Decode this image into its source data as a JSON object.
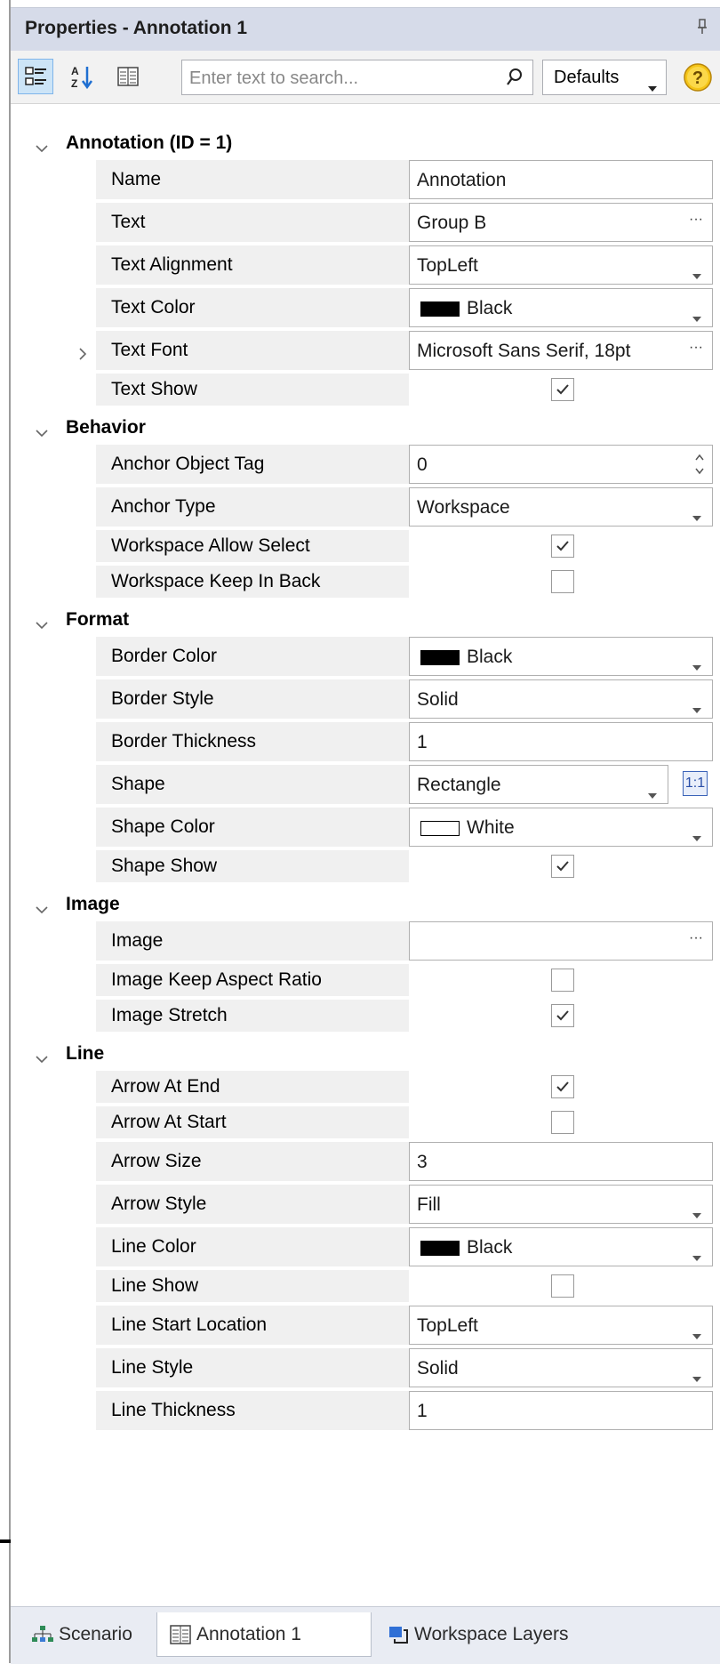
{
  "panel": {
    "title": "Properties - Annotation 1",
    "pin_icon": "pin-icon"
  },
  "toolbar": {
    "categorized_icon": "categorized-view-icon",
    "alphabetical_icon": "sort-az-icon",
    "pages_icon": "property-pages-icon",
    "search_placeholder": "Enter text to search...",
    "search_icon": "search-icon",
    "defaults_label": "Defaults",
    "help_icon": "help-icon"
  },
  "categories": [
    {
      "label": "Annotation (ID = 1)",
      "properties": [
        {
          "name": "Name",
          "type": "text",
          "value": "Annotation"
        },
        {
          "name": "Text",
          "type": "ellipsis",
          "value": "Group B"
        },
        {
          "name": "Text Alignment",
          "type": "dropdown",
          "value": "TopLeft"
        },
        {
          "name": "Text Color",
          "type": "color",
          "value": "Black",
          "swatch": "#000000"
        },
        {
          "name": "Text Font",
          "type": "ellipsis",
          "value": "Microsoft Sans Serif, 18pt",
          "expandable": true
        },
        {
          "name": "Text Show",
          "type": "checkbox",
          "checked": true
        }
      ]
    },
    {
      "label": "Behavior",
      "properties": [
        {
          "name": "Anchor Object Tag",
          "type": "spin",
          "value": "0"
        },
        {
          "name": "Anchor Type",
          "type": "dropdown",
          "value": "Workspace"
        },
        {
          "name": "Workspace Allow Select",
          "type": "checkbox",
          "checked": true
        },
        {
          "name": "Workspace Keep In Back",
          "type": "checkbox",
          "checked": false
        }
      ]
    },
    {
      "label": "Format",
      "properties": [
        {
          "name": "Border Color",
          "type": "color",
          "value": "Black",
          "swatch": "#000000"
        },
        {
          "name": "Border Style",
          "type": "dropdown",
          "value": "Solid"
        },
        {
          "name": "Border Thickness",
          "type": "text",
          "value": "1"
        },
        {
          "name": "Shape",
          "type": "shape",
          "value": "Rectangle",
          "ratio_label": "1:1"
        },
        {
          "name": "Shape Color",
          "type": "color",
          "value": "White",
          "swatch": "#ffffff"
        },
        {
          "name": "Shape Show",
          "type": "checkbox",
          "checked": true
        }
      ]
    },
    {
      "label": "Image",
      "properties": [
        {
          "name": "Image",
          "type": "ellipsis",
          "value": ""
        },
        {
          "name": "Image Keep Aspect Ratio",
          "type": "checkbox",
          "checked": false
        },
        {
          "name": "Image Stretch",
          "type": "checkbox",
          "checked": true
        }
      ]
    },
    {
      "label": "Line",
      "properties": [
        {
          "name": "Arrow At End",
          "type": "checkbox",
          "checked": true
        },
        {
          "name": "Arrow At Start",
          "type": "checkbox",
          "checked": false
        },
        {
          "name": "Arrow Size",
          "type": "text",
          "value": "3"
        },
        {
          "name": "Arrow Style",
          "type": "dropdown",
          "value": "Fill"
        },
        {
          "name": "Line Color",
          "type": "color",
          "value": "Black",
          "swatch": "#000000"
        },
        {
          "name": "Line Show",
          "type": "checkbox",
          "checked": false
        },
        {
          "name": "Line Start Location",
          "type": "dropdown",
          "value": "TopLeft"
        },
        {
          "name": "Line Style",
          "type": "dropdown",
          "value": "Solid"
        },
        {
          "name": "Line Thickness",
          "type": "text",
          "value": "1"
        }
      ]
    }
  ],
  "bottom_tabs": [
    {
      "label": "Scenario",
      "icon": "scenario-tree-icon",
      "active": false
    },
    {
      "label": "Annotation 1",
      "icon": "property-grid-icon",
      "active": true
    },
    {
      "label": "Workspace Layers",
      "icon": "layers-icon",
      "active": false
    }
  ]
}
